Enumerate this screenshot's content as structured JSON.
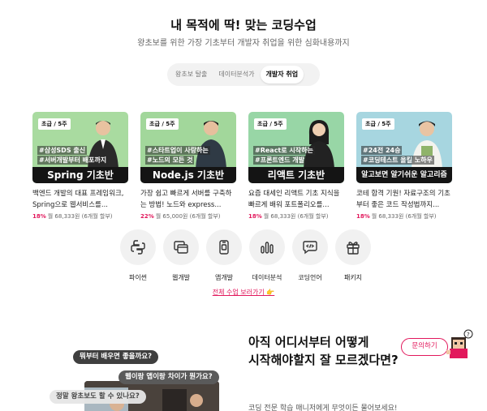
{
  "header": {
    "title": "내 목적에 딱! 맞는 코딩수업",
    "subtitle": "왕초보를 위한 가장 기초부터 개발자 취업을 위한 심화내용까지"
  },
  "tabs": [
    {
      "label": "왕초보 탈출",
      "active": false
    },
    {
      "label": "데이터분석가",
      "active": false
    },
    {
      "label": "개발자 취업",
      "active": true
    }
  ],
  "courses": [
    {
      "level": "초급 / 5주",
      "tag1": "#삼성SDS 출신",
      "tag2": "#서버개발부터 배포까지",
      "banner": "Spring 기초반",
      "title": "백엔드 개발의 대표 프레임워크, Spring으로 웹서비스를...",
      "discount": "18%",
      "price": "월 68,333원 (6개월 할부)",
      "bg": "#a9dba0"
    },
    {
      "level": "초급 / 5주",
      "tag1": "#스타트업이 사랑하는",
      "tag2": "#노드의 모든 것",
      "banner": "Node.js 기초반",
      "title": "가장 쉽고 빠르게 서버를 구축하는 방법! 노드와 express...",
      "discount": "22%",
      "price": "월 65,000원 (6개월 할부)",
      "bg": "#a2d79b"
    },
    {
      "level": "초급 / 5주",
      "tag1": "#React로 시작하는",
      "tag2": "#프론트엔드 개발",
      "banner": "리액트 기초반",
      "title": "요즘 대세인 리액트 기초 지식을 빠르게 배워 포트폴리오를...",
      "discount": "18%",
      "price": "월 68,333원 (6개월 할부)",
      "bg": "#98d6a6"
    },
    {
      "level": "초급 / 5주",
      "tag1": "#24전 24승",
      "tag2": "#코딩테스트 올킬 노하우",
      "banner": "알고보면 알기쉬운 알고리즘",
      "title": "코테 합격 기원! 자료구조의 기초부터 좋은 코드 작성법까지...",
      "discount": "18%",
      "price": "월 68,333원 (6개월 할부)",
      "bg": "#a7d6e0"
    }
  ],
  "categories": [
    {
      "label": "파이썬",
      "icon": "python-icon"
    },
    {
      "label": "웹개발",
      "icon": "web-dev-icon"
    },
    {
      "label": "앱개발",
      "icon": "mobile-app-icon"
    },
    {
      "label": "데이터분석",
      "icon": "bar-chart-icon"
    },
    {
      "label": "코딩언어",
      "icon": "code-chat-icon"
    },
    {
      "label": "패키지",
      "icon": "gift-icon"
    }
  ],
  "all_courses_link": "전체 수업 보러가기 👉",
  "consult": {
    "bubbles": [
      "뭐부터 배우면 좋을까요?",
      "웹이랑 앱이랑 차이가 뭔가요?",
      "정말 왕초보도 할 수 있나요?"
    ],
    "title_line1": "아직 어디서부터 어떻게",
    "title_line2": "시작해야할지 잘 모르겠다면?",
    "subtitle": "코딩 전문 학습 매니저에게 무엇이든 물어보세요!"
  },
  "ask_button": "문의하기",
  "colors": {
    "accent": "#e2185c",
    "banner": "#141414"
  }
}
